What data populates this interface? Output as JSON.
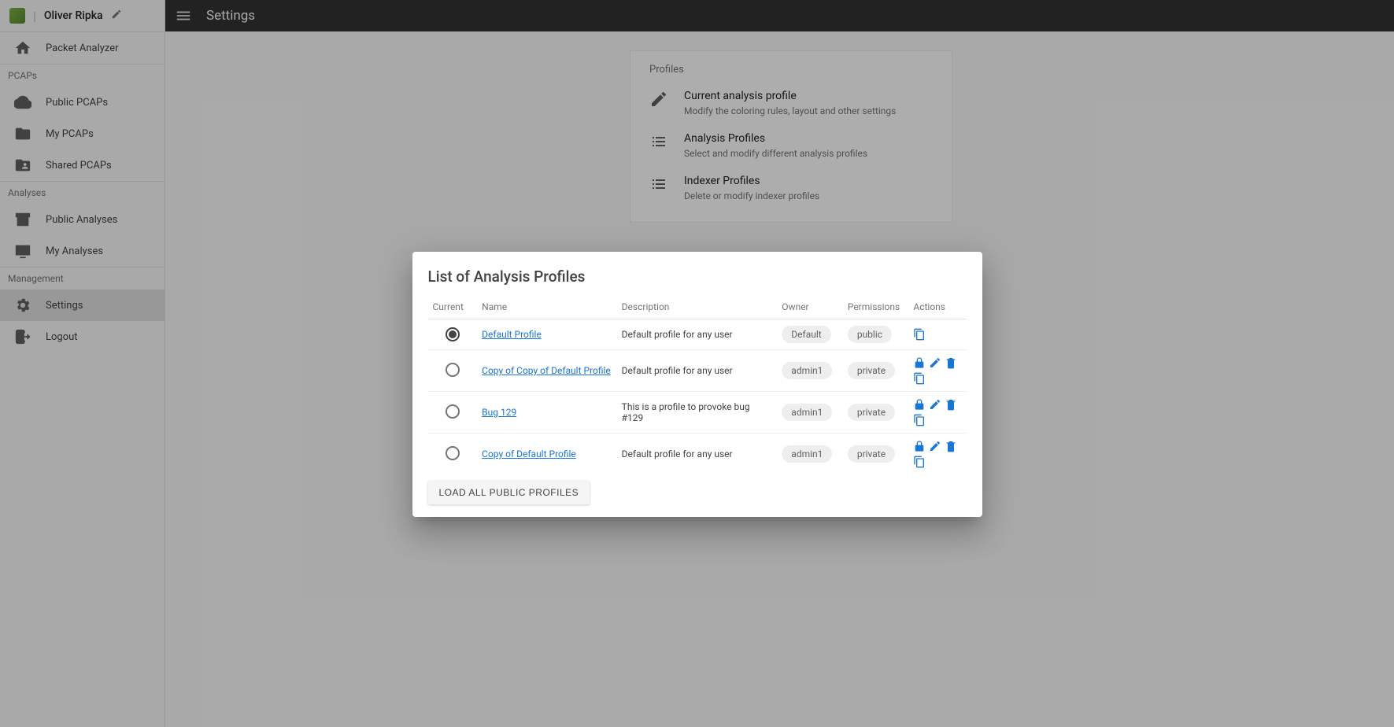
{
  "user": {
    "name": "Oliver Ripka"
  },
  "app": {
    "title": "Packet Analyzer"
  },
  "topbar": {
    "title": "Settings"
  },
  "sidebar": {
    "groups": [
      {
        "title": "",
        "items": [
          {
            "label": "Packet Analyzer",
            "icon": "home"
          }
        ]
      },
      {
        "title": "PCAPs",
        "items": [
          {
            "label": "Public PCAPs",
            "icon": "cloud"
          },
          {
            "label": "My PCAPs",
            "icon": "folder"
          },
          {
            "label": "Shared PCAPs",
            "icon": "folder-shared"
          }
        ]
      },
      {
        "title": "Analyses",
        "items": [
          {
            "label": "Public Analyses",
            "icon": "archive"
          },
          {
            "label": "My Analyses",
            "icon": "dvr"
          }
        ]
      },
      {
        "title": "Management",
        "items": [
          {
            "label": "Settings",
            "icon": "gear",
            "selected": true
          },
          {
            "label": "Logout",
            "icon": "logout"
          }
        ]
      }
    ]
  },
  "settingsCard": {
    "section": "Profiles",
    "rows": [
      {
        "title": "Current analysis profile",
        "desc": "Modify the coloring rules, layout and other settings",
        "icon": "pencil"
      },
      {
        "title": "Analysis Profiles",
        "desc": "Select and modify different analysis profiles",
        "icon": "list"
      },
      {
        "title": "Indexer Profiles",
        "desc": "Delete or modify indexer profiles",
        "icon": "list"
      }
    ]
  },
  "dialog": {
    "title": "List of Analysis Profiles",
    "columns": {
      "current": "Current",
      "name": "Name",
      "desc": "Description",
      "owner": "Owner",
      "perm": "Permissions",
      "actions": "Actions"
    },
    "rows": [
      {
        "current": true,
        "name": "Default Profile",
        "desc": "Default profile for any user",
        "owner": "Default",
        "perm": "public",
        "actions": [
          "copy"
        ]
      },
      {
        "current": false,
        "name": "Copy of Copy of Default Profile",
        "desc": "Default profile for any user",
        "owner": "admin1",
        "perm": "private",
        "actions": [
          "lock",
          "edit",
          "delete",
          "copy"
        ]
      },
      {
        "current": false,
        "name": "Bug 129",
        "desc": "This is a profile to provoke bug #129",
        "owner": "admin1",
        "perm": "private",
        "actions": [
          "lock",
          "edit",
          "delete",
          "copy"
        ]
      },
      {
        "current": false,
        "name": "Copy of Default Profile",
        "desc": "Default profile for any user",
        "owner": "admin1",
        "perm": "private",
        "actions": [
          "lock",
          "edit",
          "delete",
          "copy"
        ]
      }
    ],
    "loadButton": "LOAD ALL PUBLIC PROFILES"
  }
}
